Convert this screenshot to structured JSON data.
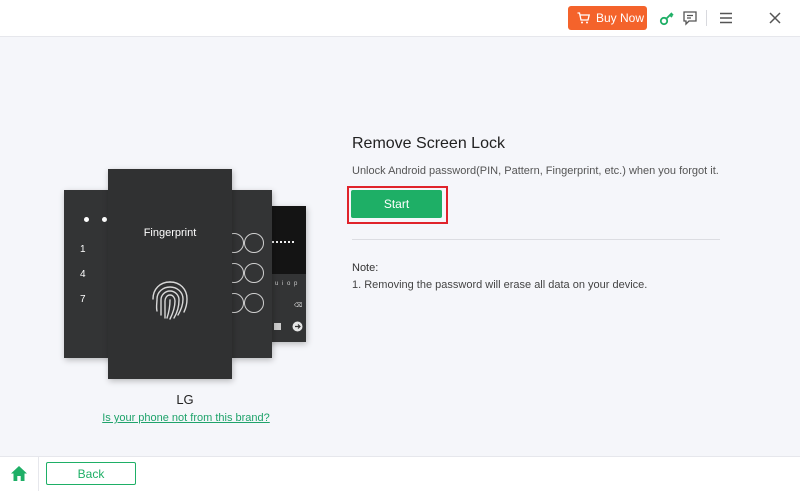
{
  "titlebar": {
    "buy_now_label": "Buy Now",
    "icons": [
      "cart-icon",
      "key-icon",
      "feedback-icon",
      "menu-icon",
      "close-icon"
    ]
  },
  "illustration": {
    "pin_numbers": [
      "1",
      "4",
      "7"
    ],
    "fingerprint_label": "Fingerprint",
    "keyboard_text": "u i o p"
  },
  "brand": {
    "name": "LG",
    "change_link": "Is your phone not from this brand?"
  },
  "content": {
    "title": "Remove Screen Lock",
    "subtitle": "Unlock Android password(PIN, Pattern, Fingerprint, etc.) when you forgot it.",
    "start_label": "Start",
    "note_title": "Note:",
    "note_items": [
      "1. Removing the password will erase all data on your device."
    ]
  },
  "bottombar": {
    "back_label": "Back"
  },
  "colors": {
    "accent": "#1eaf66",
    "buy_now": "#f4632b",
    "highlight": "#e0232b",
    "card": "#333435"
  }
}
